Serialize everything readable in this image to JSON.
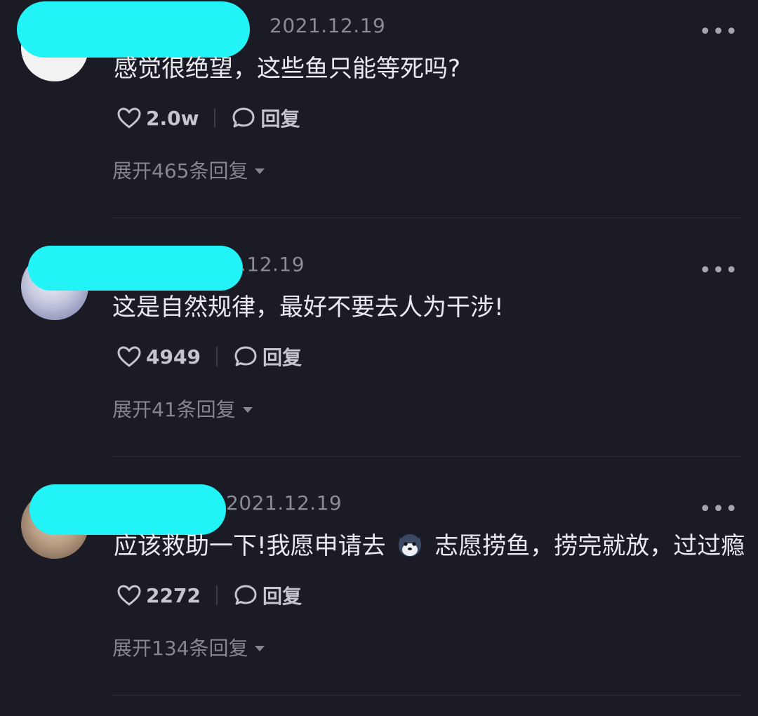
{
  "colors": {
    "background": "#1a1b25",
    "redaction": "#21f3f6",
    "text": "#e9e9ee",
    "muted": "#85868e"
  },
  "comments": [
    {
      "time": "2021.12.19",
      "text": "感觉很绝望，这些鱼只能等死吗?",
      "likes": "2.0w",
      "reply_label": "回复",
      "expand_label": "展开465条回复"
    },
    {
      "time": ".12.19",
      "text": "这是自然规律，最好不要去人为干涉!",
      "likes": "4949",
      "reply_label": "回复",
      "expand_label": "展开41条回复"
    },
    {
      "time": "2021.12.19",
      "text_before": "应该救助一下!我愿申请去",
      "emoji": "fox-emoji",
      "text_after": "志愿捞鱼，捞完就放，过过瘾",
      "likes": "2272",
      "reply_label": "回复",
      "expand_label": "展开134条回复"
    }
  ],
  "icons": {
    "like": "heart-outline-icon",
    "reply": "speech-bubble-icon",
    "more": "more-dots-icon",
    "expand": "caret-down-icon"
  }
}
